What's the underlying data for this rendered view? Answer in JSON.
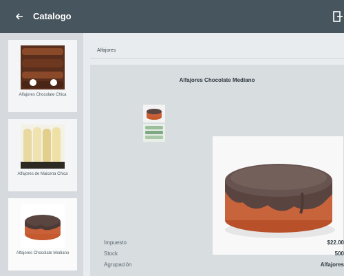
{
  "appbar": {
    "title": "Catalogo",
    "back_icon": "arrow-left-icon",
    "exit_icon": "exit-icon",
    "color": "#47565e"
  },
  "sidebar": {
    "items": [
      {
        "label": "Alfajores Chocolate Chica",
        "selected": false,
        "icon": "alfajores-chocolate-chica-image"
      },
      {
        "label": "Alfajores de Maicena Chica",
        "selected": false,
        "icon": "alfajores-maicena-chica-image"
      },
      {
        "label": "Alfajores Chocolate Mediano",
        "selected": true,
        "icon": "alfajor-chocolate-mediano-image"
      }
    ]
  },
  "main": {
    "breadcrumb": "Alfajores",
    "product": {
      "title": "Alfajores Chocolate Mediano",
      "thumbnails": [
        "alfajor-thumbnail-image",
        "maicena-thumbnail-image"
      ],
      "main_image": "alfajor-chocolate-mediano-image",
      "info": [
        {
          "label": "Impuesto",
          "value": "$22.00"
        },
        {
          "label": "Stock",
          "value": "500"
        },
        {
          "label": "Agrupación",
          "value": "Alfajores"
        }
      ]
    }
  }
}
